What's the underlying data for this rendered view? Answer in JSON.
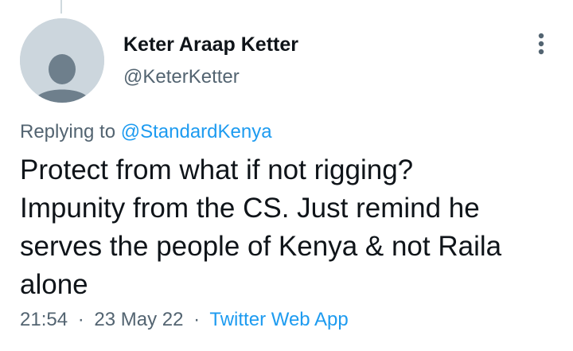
{
  "author": {
    "name": "Keter Araap Ketter",
    "handle": "@KeterKetter"
  },
  "reply": {
    "prefix": "Replying to",
    "mention": "@StandardKenya"
  },
  "tweet": {
    "lines": [
      "Protect from what if not rigging?",
      "Impunity from the CS. Just remind he",
      "serves the people of Kenya & not Raila",
      "alone"
    ]
  },
  "meta": {
    "time": "21:54",
    "separator": "·",
    "date": "23 May 22",
    "source": "Twitter Web App"
  },
  "icons": {
    "avatar": "default-avatar-icon",
    "more": "more-vertical-icon"
  },
  "colors": {
    "accent": "#1d9bf0",
    "secondary_text": "#536471",
    "avatar_bg": "#ccd6dd",
    "avatar_figure": "#6e7f8c"
  }
}
